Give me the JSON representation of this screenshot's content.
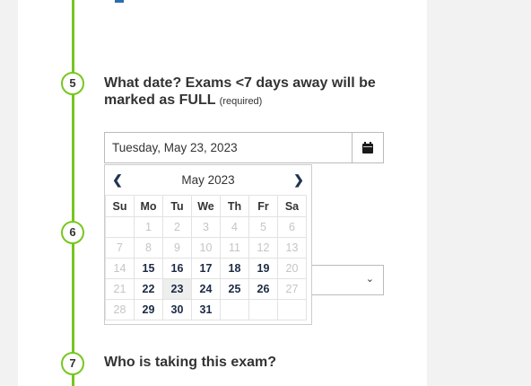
{
  "steps": {
    "step5": {
      "number": "5",
      "question": "What date? Exams <7 days away will be marked as FULL",
      "required": "(required)"
    },
    "step6": {
      "number": "6"
    },
    "step7": {
      "number": "7",
      "question": "Who is taking this exam?"
    }
  },
  "date_field": {
    "value": "Tuesday, May 23, 2023",
    "button_icon": "calendar-icon"
  },
  "datepicker": {
    "month_label": "May 2023",
    "prev_icon": "chevron-left-icon",
    "next_icon": "chevron-right-icon",
    "weekdays": [
      "Su",
      "Mo",
      "Tu",
      "We",
      "Th",
      "Fr",
      "Sa"
    ],
    "weeks": [
      [
        {
          "d": "",
          "s": "empty"
        },
        {
          "d": "1",
          "s": "disabled"
        },
        {
          "d": "2",
          "s": "disabled"
        },
        {
          "d": "3",
          "s": "disabled"
        },
        {
          "d": "4",
          "s": "disabled"
        },
        {
          "d": "5",
          "s": "disabled"
        },
        {
          "d": "6",
          "s": "disabled"
        }
      ],
      [
        {
          "d": "7",
          "s": "disabled"
        },
        {
          "d": "8",
          "s": "disabled"
        },
        {
          "d": "9",
          "s": "disabled"
        },
        {
          "d": "10",
          "s": "disabled"
        },
        {
          "d": "11",
          "s": "disabled"
        },
        {
          "d": "12",
          "s": "disabled"
        },
        {
          "d": "13",
          "s": "disabled"
        }
      ],
      [
        {
          "d": "14",
          "s": "disabled"
        },
        {
          "d": "15",
          "s": "enabled"
        },
        {
          "d": "16",
          "s": "enabled"
        },
        {
          "d": "17",
          "s": "enabled"
        },
        {
          "d": "18",
          "s": "enabled"
        },
        {
          "d": "19",
          "s": "enabled"
        },
        {
          "d": "20",
          "s": "disabled"
        }
      ],
      [
        {
          "d": "21",
          "s": "disabled"
        },
        {
          "d": "22",
          "s": "enabled"
        },
        {
          "d": "23",
          "s": "selected"
        },
        {
          "d": "24",
          "s": "enabled"
        },
        {
          "d": "25",
          "s": "enabled"
        },
        {
          "d": "26",
          "s": "enabled"
        },
        {
          "d": "27",
          "s": "disabled"
        }
      ],
      [
        {
          "d": "28",
          "s": "disabled"
        },
        {
          "d": "29",
          "s": "enabled"
        },
        {
          "d": "30",
          "s": "enabled"
        },
        {
          "d": "31",
          "s": "enabled"
        },
        {
          "d": "",
          "s": "empty"
        },
        {
          "d": "",
          "s": "empty"
        },
        {
          "d": "",
          "s": "empty"
        }
      ]
    ]
  },
  "select_field": {
    "chevron_icon": "chevron-down-icon"
  },
  "colors": {
    "timeline_green": "#77c720",
    "date_text_navy": "#1c2a44",
    "disabled_gray": "#c5c5c5"
  }
}
